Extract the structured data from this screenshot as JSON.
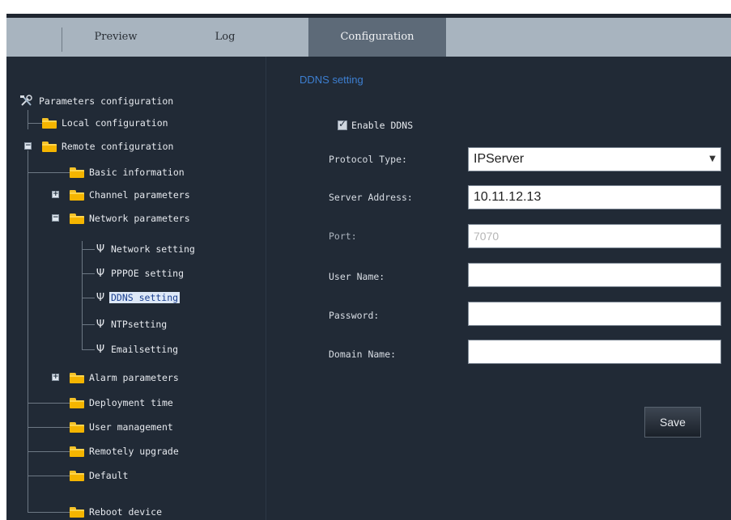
{
  "tabs": [
    {
      "label": "Preview",
      "active": false
    },
    {
      "label": "Log",
      "active": false
    },
    {
      "label": "Configuration",
      "active": true
    }
  ],
  "tree": {
    "root": "Parameters configuration",
    "local": "Local configuration",
    "remote": "Remote configuration",
    "basic": "Basic information",
    "channel": "Channel parameters",
    "network": "Network parameters",
    "network_setting": "Network setting",
    "pppoe_setting": "PPPOE setting",
    "ddns_setting": "DDNS setting",
    "ntp_setting": "NTPsetting",
    "email_setting": "Emailsetting",
    "alarm": "Alarm parameters",
    "deployment": "Deployment time",
    "user": "User management",
    "upgrade": "Remotely upgrade",
    "default": "Default",
    "reboot": "Reboot device"
  },
  "form": {
    "title": "DDNS setting",
    "enable_label": "Enable DDNS",
    "enable_checked": true,
    "protocol_label": "Protocol Type:",
    "protocol_value": "IPServer",
    "server_label": "Server Address:",
    "server_value": "10.11.12.13",
    "port_label": "Port:",
    "port_value": "7070",
    "username_label": "User Name:",
    "username_value": "",
    "password_label": "Password:",
    "password_value": "",
    "domain_label": "Domain Name:",
    "domain_value": "",
    "save_label": "Save"
  },
  "colors": {
    "background": "#212a36",
    "tabbar": "#a8b4bf",
    "active_tab": "#5d6a78",
    "accent": "#3d7fd1",
    "folder": "#f5b500"
  }
}
